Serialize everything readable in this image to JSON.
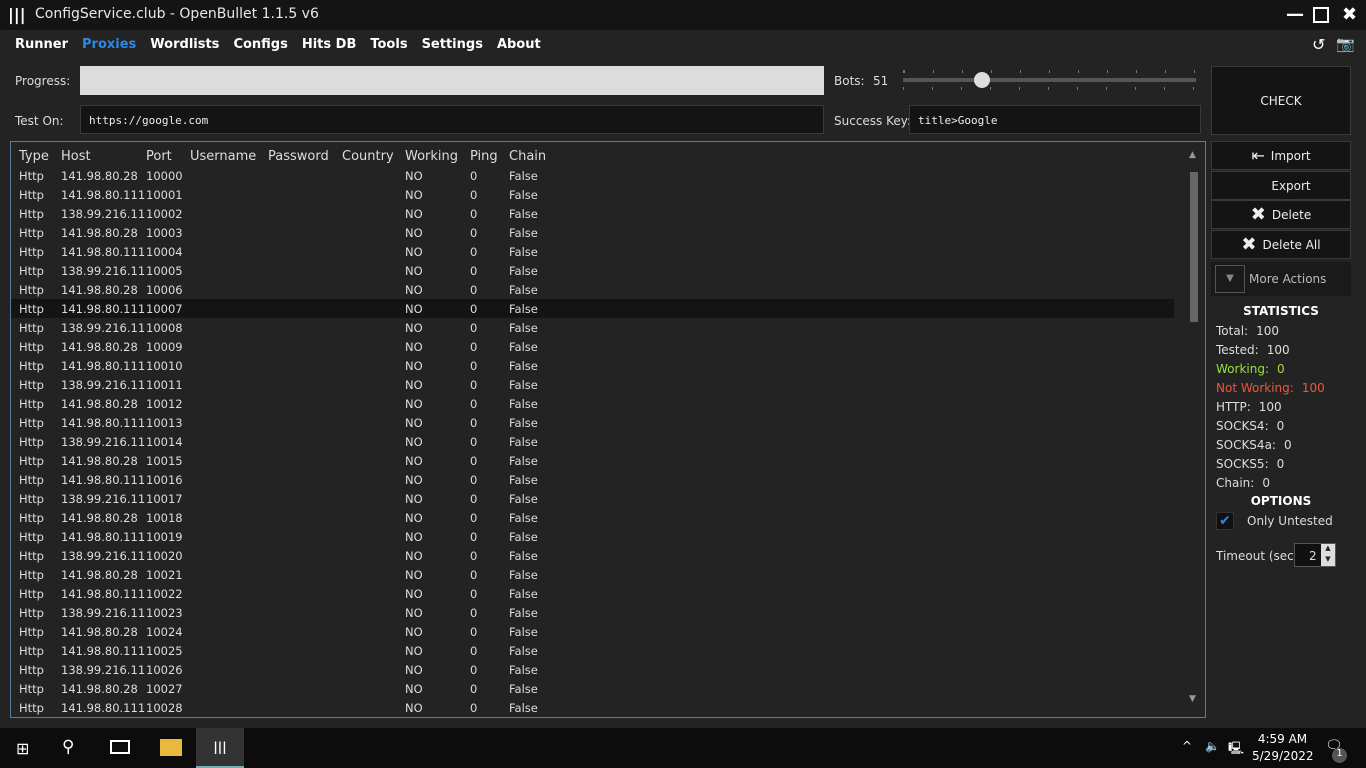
{
  "window": {
    "title": "ConfigService.club - OpenBullet 1.1.5 v6"
  },
  "menu": [
    "Runner",
    "Proxies",
    "Wordlists",
    "Configs",
    "Hits DB",
    "Tools",
    "Settings",
    "About"
  ],
  "controls": {
    "progress_label": "Progress:",
    "progress": 0,
    "bots_label": "Bots:",
    "bots": "51",
    "bots_fraction": 0.27,
    "test_on_label": "Test On:",
    "test_on": "https://google.com",
    "success_key_label": "Success Key:",
    "success_key": "title>Google",
    "check": "CHECK"
  },
  "columns": [
    "Type",
    "Host",
    "Port",
    "Username",
    "Password",
    "Country",
    "Working",
    "Ping",
    "Chain"
  ],
  "rows": [
    [
      "Http",
      "141.98.80.28",
      "10000",
      "NO",
      "0",
      "False"
    ],
    [
      "Http",
      "141.98.80.111",
      "10001",
      "NO",
      "0",
      "False"
    ],
    [
      "Http",
      "138.99.216.11",
      "10002",
      "NO",
      "0",
      "False"
    ],
    [
      "Http",
      "141.98.80.28",
      "10003",
      "NO",
      "0",
      "False"
    ],
    [
      "Http",
      "141.98.80.111",
      "10004",
      "NO",
      "0",
      "False"
    ],
    [
      "Http",
      "138.99.216.11",
      "10005",
      "NO",
      "0",
      "False"
    ],
    [
      "Http",
      "141.98.80.28",
      "10006",
      "NO",
      "0",
      "False"
    ],
    [
      "Http",
      "141.98.80.111",
      "10007",
      "NO",
      "0",
      "False"
    ],
    [
      "Http",
      "138.99.216.11",
      "10008",
      "NO",
      "0",
      "False"
    ],
    [
      "Http",
      "141.98.80.28",
      "10009",
      "NO",
      "0",
      "False"
    ],
    [
      "Http",
      "141.98.80.111",
      "10010",
      "NO",
      "0",
      "False"
    ],
    [
      "Http",
      "138.99.216.11",
      "10011",
      "NO",
      "0",
      "False"
    ],
    [
      "Http",
      "141.98.80.28",
      "10012",
      "NO",
      "0",
      "False"
    ],
    [
      "Http",
      "141.98.80.111",
      "10013",
      "NO",
      "0",
      "False"
    ],
    [
      "Http",
      "138.99.216.11",
      "10014",
      "NO",
      "0",
      "False"
    ],
    [
      "Http",
      "141.98.80.28",
      "10015",
      "NO",
      "0",
      "False"
    ],
    [
      "Http",
      "141.98.80.111",
      "10016",
      "NO",
      "0",
      "False"
    ],
    [
      "Http",
      "138.99.216.11",
      "10017",
      "NO",
      "0",
      "False"
    ],
    [
      "Http",
      "141.98.80.28",
      "10018",
      "NO",
      "0",
      "False"
    ],
    [
      "Http",
      "141.98.80.111",
      "10019",
      "NO",
      "0",
      "False"
    ],
    [
      "Http",
      "138.99.216.11",
      "10020",
      "NO",
      "0",
      "False"
    ],
    [
      "Http",
      "141.98.80.28",
      "10021",
      "NO",
      "0",
      "False"
    ],
    [
      "Http",
      "141.98.80.111",
      "10022",
      "NO",
      "0",
      "False"
    ],
    [
      "Http",
      "138.99.216.11",
      "10023",
      "NO",
      "0",
      "False"
    ],
    [
      "Http",
      "141.98.80.28",
      "10024",
      "NO",
      "0",
      "False"
    ],
    [
      "Http",
      "141.98.80.111",
      "10025",
      "NO",
      "0",
      "False"
    ],
    [
      "Http",
      "138.99.216.11",
      "10026",
      "NO",
      "0",
      "False"
    ],
    [
      "Http",
      "141.98.80.28",
      "10027",
      "NO",
      "0",
      "False"
    ],
    [
      "Http",
      "141.98.80.111",
      "10028",
      "NO",
      "0",
      "False"
    ]
  ],
  "selected_row": 7,
  "actions": {
    "import": "Import",
    "export": "Export",
    "delete": "Delete",
    "delete_all": "Delete All",
    "more": "More Actions"
  },
  "stats": {
    "title": "STATISTICS",
    "items": [
      {
        "label": "Total:",
        "value": "100",
        "color": "#dddddd"
      },
      {
        "label": "Tested:",
        "value": "100",
        "color": "#dddddd"
      },
      {
        "label": "Working:",
        "value": "0",
        "color": "#9be03a"
      },
      {
        "label": "Not Working:",
        "value": "100",
        "color": "#f0543c"
      },
      {
        "label": "HTTP:",
        "value": "100",
        "color": "#dddddd"
      },
      {
        "label": "SOCKS4:",
        "value": "0",
        "color": "#dddddd"
      },
      {
        "label": "SOCKS4a:",
        "value": "0",
        "color": "#dddddd"
      },
      {
        "label": "SOCKS5:",
        "value": "0",
        "color": "#dddddd"
      },
      {
        "label": "Chain:",
        "value": "0",
        "color": "#dddddd"
      }
    ]
  },
  "options": {
    "title": "OPTIONS",
    "only_untested": "Only Untested",
    "timeout_label": "Timeout (sec):",
    "timeout": "2"
  },
  "taskbar": {
    "time": "4:59 AM",
    "date": "5/29/2022",
    "notifications": "1"
  }
}
